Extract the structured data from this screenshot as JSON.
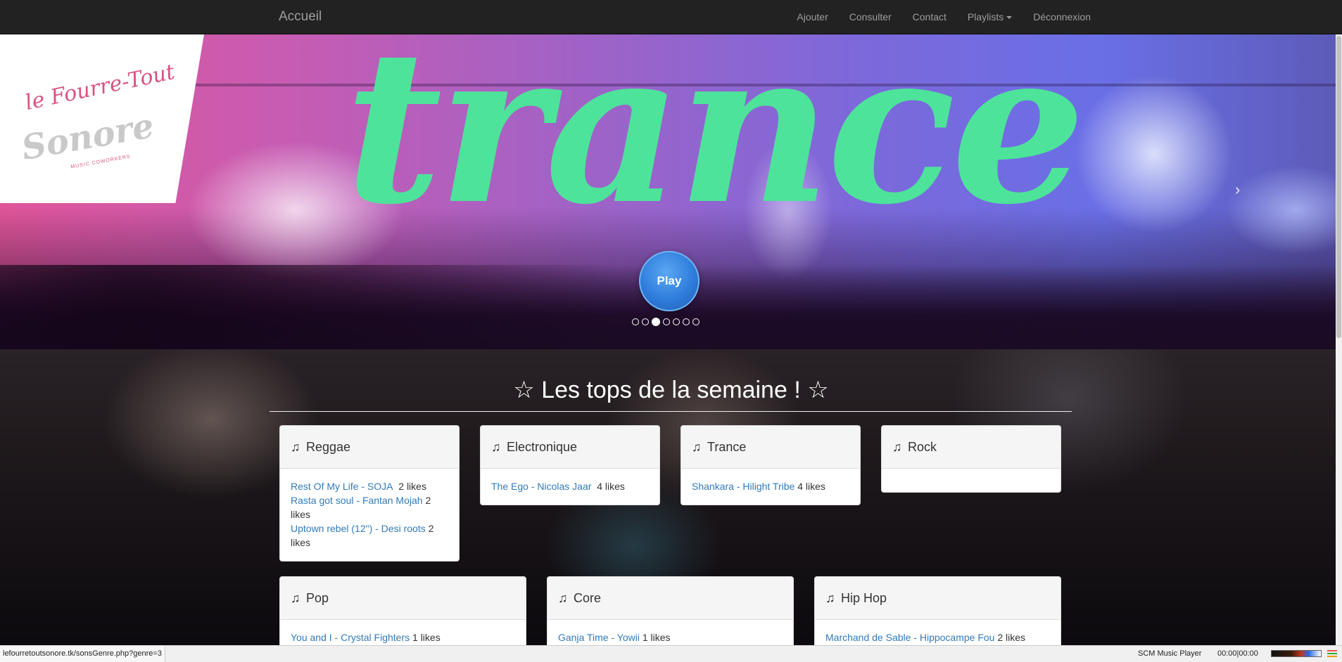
{
  "navbar": {
    "brand": "Accueil",
    "links": [
      "Ajouter",
      "Consulter",
      "Contact",
      "Playlists",
      "Déconnexion"
    ]
  },
  "hero": {
    "logo": {
      "line1": "le Fourre-Tout",
      "line2": "Sonore",
      "line3": "MUSIC COWORKERS"
    },
    "genre_title": "trance",
    "prev_label": "‹",
    "next_label": "›",
    "play_label": "Play",
    "indicators": {
      "count": 7,
      "active_index": 2
    }
  },
  "tops": {
    "title": "☆ Les tops de la semaine ! ☆",
    "note_icon": "♫",
    "panels": [
      {
        "genre": "Reggae",
        "songs": [
          {
            "title": "Rest Of My Life - SOJA",
            "likes": "2 likes"
          },
          {
            "title": "Rasta got soul - Fantan Mojah",
            "likes": "2 likes"
          },
          {
            "title": "Uptown rebel (12\") - Desi roots",
            "likes": "2 likes"
          }
        ]
      },
      {
        "genre": "Electronique",
        "songs": [
          {
            "title": "The Ego - Nicolas Jaar",
            "likes": "4 likes"
          }
        ]
      },
      {
        "genre": "Trance",
        "songs": [
          {
            "title": "Shankara - Hilight Tribe",
            "likes": "4 likes"
          }
        ]
      },
      {
        "genre": "Rock",
        "songs": []
      },
      {
        "genre": "Pop",
        "songs": [
          {
            "title": "You and I - Crystal Fighters",
            "likes": "1 likes"
          }
        ]
      },
      {
        "genre": "Core",
        "songs": [
          {
            "title": "Ganja Time - Yowii",
            "likes": "1 likes"
          }
        ]
      },
      {
        "genre": "Hip Hop",
        "songs": [
          {
            "title": "Marchand de Sable - Hippocampe Fou",
            "likes": "2 likes"
          }
        ]
      }
    ]
  },
  "statusbar": {
    "url": "lefourretoutsonore.tk/sonsGenre.php?genre=3",
    "player_name": "SCM Music Player",
    "player_time": "00:00|00:00"
  },
  "colors": {
    "navbar_bg": "#222222",
    "nav_text": "#9d9d9d",
    "genre_title": "#4ee39a",
    "play_button": "#2f7ddb",
    "link": "#337ab7"
  }
}
